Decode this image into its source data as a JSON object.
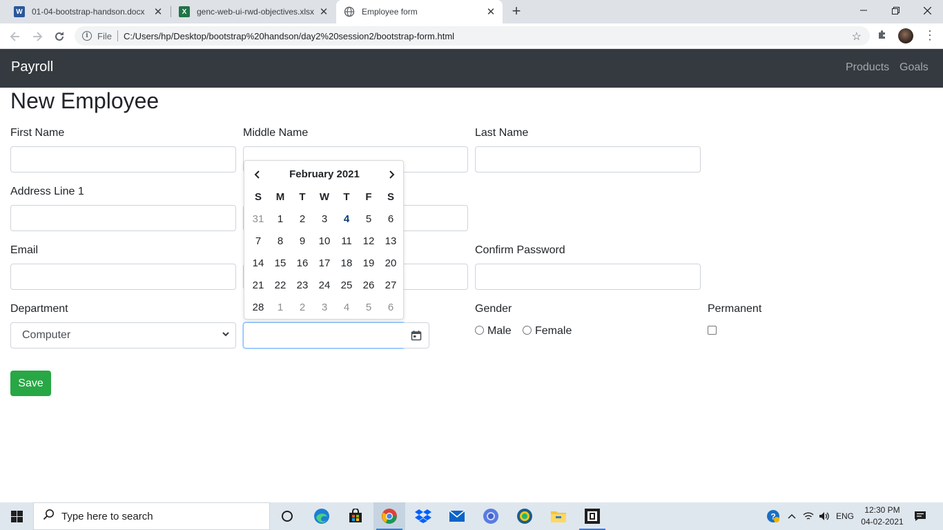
{
  "browser": {
    "tabs": [
      {
        "label": "01-04-bootstrap-handson.docx",
        "icon": "word-icon",
        "active": false
      },
      {
        "label": "genc-web-ui-rwd-objectives.xlsx",
        "icon": "excel-icon",
        "active": false
      },
      {
        "label": "Employee form",
        "icon": "globe-icon",
        "active": true
      }
    ],
    "new_tab": "+",
    "address": {
      "scheme_label": "File",
      "url": "C:/Users/hp/Desktop/bootstrap%20handson/day2%20session2/bootstrap-form.html"
    }
  },
  "navbar": {
    "brand": "Payroll",
    "links": [
      "Products",
      "Goals"
    ]
  },
  "form": {
    "title": "New Employee",
    "labels": {
      "first_name": "First Name",
      "middle_name": "Middle Name",
      "last_name": "Last Name",
      "address1": "Address Line 1",
      "email": "Email",
      "confirm_password": "Confirm Password",
      "department": "Department",
      "gender": "Gender",
      "permanent": "Permanent"
    },
    "department_value": "Computer",
    "gender_options": [
      "Male",
      "Female"
    ],
    "save_label": "Save"
  },
  "datepicker": {
    "month_label": "February 2021",
    "weekdays": [
      "S",
      "M",
      "T",
      "W",
      "T",
      "F",
      "S"
    ],
    "weeks": [
      [
        {
          "d": "31",
          "m": true
        },
        {
          "d": "1"
        },
        {
          "d": "2"
        },
        {
          "d": "3"
        },
        {
          "d": "4",
          "today": true
        },
        {
          "d": "5"
        },
        {
          "d": "6"
        }
      ],
      [
        {
          "d": "7"
        },
        {
          "d": "8"
        },
        {
          "d": "9"
        },
        {
          "d": "10"
        },
        {
          "d": "11"
        },
        {
          "d": "12"
        },
        {
          "d": "13"
        }
      ],
      [
        {
          "d": "14"
        },
        {
          "d": "15"
        },
        {
          "d": "16"
        },
        {
          "d": "17"
        },
        {
          "d": "18"
        },
        {
          "d": "19"
        },
        {
          "d": "20"
        }
      ],
      [
        {
          "d": "21"
        },
        {
          "d": "22"
        },
        {
          "d": "23"
        },
        {
          "d": "24"
        },
        {
          "d": "25"
        },
        {
          "d": "26"
        },
        {
          "d": "27"
        }
      ],
      [
        {
          "d": "28"
        },
        {
          "d": "1",
          "m": true
        },
        {
          "d": "2",
          "m": true
        },
        {
          "d": "3",
          "m": true
        },
        {
          "d": "4",
          "m": true
        },
        {
          "d": "5",
          "m": true
        },
        {
          "d": "6",
          "m": true
        }
      ]
    ]
  },
  "taskbar": {
    "search_placeholder": "Type here to search",
    "language": "ENG",
    "time": "12:30 PM",
    "date": "04-02-2021"
  },
  "colors": {
    "navbar_bg": "#343a40",
    "save_button": "#28a745",
    "focus_border": "#80bdff",
    "today": "#0a3a7a"
  }
}
